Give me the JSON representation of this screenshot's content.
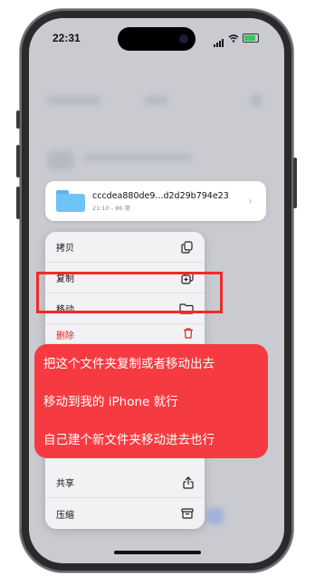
{
  "status_bar": {
    "time": "22:31"
  },
  "file": {
    "name": "cccdea880de9...d2d29b794e23",
    "meta": "21:10 - 86 项"
  },
  "menu": {
    "copy": "拷贝",
    "duplicate": "复制",
    "move": "移动",
    "delete": "删除",
    "share": "共享",
    "compress": "压缩"
  },
  "overlay": {
    "line1": "把这个文件夹复制或者移动出去",
    "line2": "移动到我的 iPhone 就行",
    "line3": "自己建个新文件夹移动进去也行"
  },
  "colors": {
    "accent_red": "#f53b41",
    "highlight_border": "#ef2a2a",
    "folder_blue": "#6ec3f7"
  }
}
